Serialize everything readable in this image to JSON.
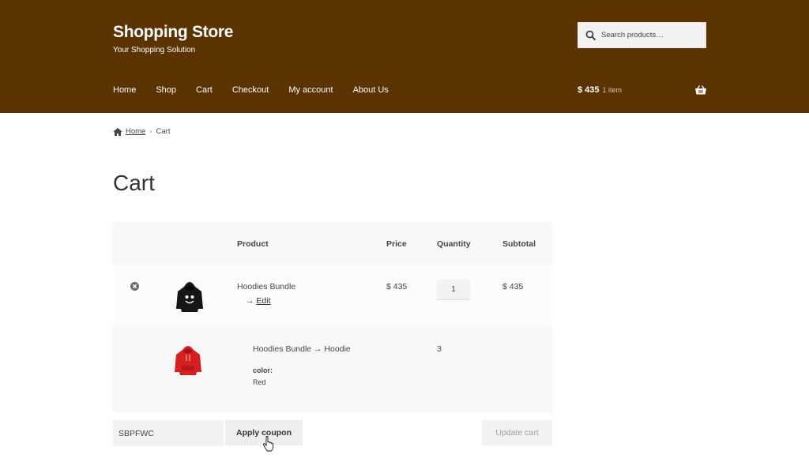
{
  "header": {
    "site_title": "Shopping Store",
    "tagline": "Your Shopping Solution",
    "search_placeholder": "Search products…",
    "nav": [
      "Home",
      "Shop",
      "Cart",
      "Checkout",
      "My account",
      "About Us"
    ],
    "cart_total": "$ 435",
    "cart_count": "1 item",
    "colors": {
      "header_bg": "#5a3300",
      "header_text": "#ffffff"
    },
    "icons": {
      "search": "search-icon",
      "cart": "basket-icon"
    }
  },
  "breadcrumb": {
    "home": "Home",
    "separator": "›",
    "current": "Cart"
  },
  "page_title": "Cart",
  "cart_table": {
    "headers": {
      "product": "Product",
      "price": "Price",
      "quantity": "Quantity",
      "subtotal": "Subtotal"
    },
    "rows": [
      {
        "product": "Hoodies Bundle",
        "edit_arrow": "→",
        "edit_label": "Edit",
        "price": "$ 435",
        "quantity": "1",
        "subtotal": "$ 435"
      },
      {
        "product": "Hoodies Bundle → Hoodie",
        "quantity": "3",
        "attr_label": "color:",
        "attr_value": "Red"
      }
    ]
  },
  "coupon": {
    "code": "SBPFWC",
    "apply_label": "Apply coupon"
  },
  "update_label": "Update cart"
}
